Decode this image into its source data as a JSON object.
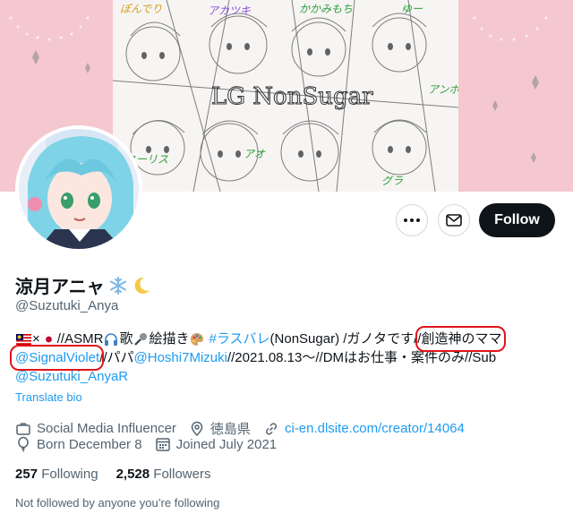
{
  "banner": {
    "title_art": "LG NonSugar",
    "member_tags": [
      "ぽんでり",
      "アカツキ",
      "かかみもち",
      "ゆー",
      "アンボ",
      "ユーリス",
      "アオ",
      "グラ"
    ]
  },
  "actions": {
    "more_icon": "more-horizontal-icon",
    "message_icon": "envelope-icon",
    "follow_label": "Follow"
  },
  "profile": {
    "display_name": "涼月アニャ",
    "name_emojis": [
      "snowflake-icon",
      "crescent-moon-icon"
    ],
    "handle": "@Suzutuki_Anya"
  },
  "bio": {
    "line1_a": "×",
    "line1_b": "//ASMR",
    "line1_c": "歌",
    "line1_d": "絵描き",
    "line1_hashtag": "#ラスバレ",
    "line1_e": "(NonSugar) /ガノタです//",
    "line1_circled": "創造神のママ",
    "line2_mention1": "@SignalViolet",
    "line2_a": "//パパ",
    "line2_mention2": "@Hoshi7Mizuki",
    "line2_b": " //2021.08.13～//DMはお仕事・案件のみ//Sub",
    "line3_mention": "@Suzutuki_AnyaR"
  },
  "translate_label": "Translate bio",
  "meta": {
    "category": "Social Media Influencer",
    "location": "徳島県",
    "website": "ci-en.dlsite.com/creator/14064",
    "born": "Born December 8",
    "joined": "Joined July 2021"
  },
  "stats": {
    "following_count": "257",
    "following_label": "Following",
    "followers_count": "2,528",
    "followers_label": "Followers"
  },
  "not_followed_text": "Not followed by anyone you’re following",
  "colors": {
    "accent": "#1d9bf0",
    "text": "#0f1419",
    "muted": "#536471",
    "banner_pink": "#f4c8ce",
    "highlight_red": "#e0141b"
  }
}
